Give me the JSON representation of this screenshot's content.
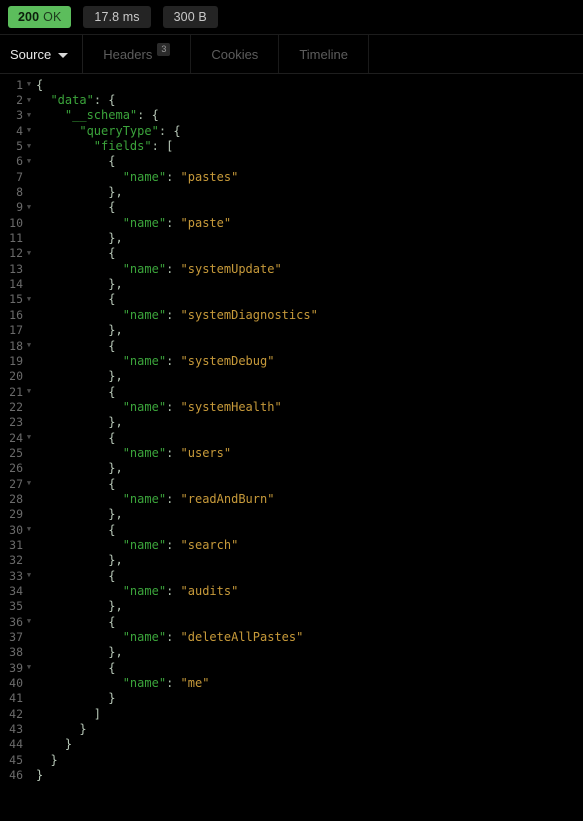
{
  "status": {
    "code": "200",
    "phrase": "OK",
    "code_color": "#5cbd5c",
    "time": "17.8 ms",
    "size": "300 B"
  },
  "tabs": {
    "source_label": "Source",
    "items": [
      {
        "label": "Headers",
        "badge": "3",
        "active": false
      },
      {
        "label": "Cookies",
        "badge": "",
        "active": false
      },
      {
        "label": "Timeline",
        "badge": "",
        "active": false
      }
    ]
  },
  "code": {
    "language": "json",
    "line_count": 46,
    "lines": [
      {
        "n": "1",
        "fold": true,
        "text": "{"
      },
      {
        "n": "2",
        "fold": true,
        "text": "  \"data\": {"
      },
      {
        "n": "3",
        "fold": true,
        "text": "    \"__schema\": {"
      },
      {
        "n": "4",
        "fold": true,
        "text": "      \"queryType\": {"
      },
      {
        "n": "5",
        "fold": true,
        "text": "        \"fields\": ["
      },
      {
        "n": "6",
        "fold": true,
        "text": "          {"
      },
      {
        "n": "7",
        "fold": false,
        "text": "            \"name\": \"pastes\""
      },
      {
        "n": "8",
        "fold": false,
        "text": "          },"
      },
      {
        "n": "9",
        "fold": true,
        "text": "          {"
      },
      {
        "n": "10",
        "fold": false,
        "text": "            \"name\": \"paste\""
      },
      {
        "n": "11",
        "fold": false,
        "text": "          },"
      },
      {
        "n": "12",
        "fold": true,
        "text": "          {"
      },
      {
        "n": "13",
        "fold": false,
        "text": "            \"name\": \"systemUpdate\""
      },
      {
        "n": "14",
        "fold": false,
        "text": "          },"
      },
      {
        "n": "15",
        "fold": true,
        "text": "          {"
      },
      {
        "n": "16",
        "fold": false,
        "text": "            \"name\": \"systemDiagnostics\""
      },
      {
        "n": "17",
        "fold": false,
        "text": "          },"
      },
      {
        "n": "18",
        "fold": true,
        "text": "          {"
      },
      {
        "n": "19",
        "fold": false,
        "text": "            \"name\": \"systemDebug\""
      },
      {
        "n": "20",
        "fold": false,
        "text": "          },"
      },
      {
        "n": "21",
        "fold": true,
        "text": "          {"
      },
      {
        "n": "22",
        "fold": false,
        "text": "            \"name\": \"systemHealth\""
      },
      {
        "n": "23",
        "fold": false,
        "text": "          },"
      },
      {
        "n": "24",
        "fold": true,
        "text": "          {"
      },
      {
        "n": "25",
        "fold": false,
        "text": "            \"name\": \"users\""
      },
      {
        "n": "26",
        "fold": false,
        "text": "          },"
      },
      {
        "n": "27",
        "fold": true,
        "text": "          {"
      },
      {
        "n": "28",
        "fold": false,
        "text": "            \"name\": \"readAndBurn\""
      },
      {
        "n": "29",
        "fold": false,
        "text": "          },"
      },
      {
        "n": "30",
        "fold": true,
        "text": "          {"
      },
      {
        "n": "31",
        "fold": false,
        "text": "            \"name\": \"search\""
      },
      {
        "n": "32",
        "fold": false,
        "text": "          },"
      },
      {
        "n": "33",
        "fold": true,
        "text": "          {"
      },
      {
        "n": "34",
        "fold": false,
        "text": "            \"name\": \"audits\""
      },
      {
        "n": "35",
        "fold": false,
        "text": "          },"
      },
      {
        "n": "36",
        "fold": true,
        "text": "          {"
      },
      {
        "n": "37",
        "fold": false,
        "text": "            \"name\": \"deleteAllPastes\""
      },
      {
        "n": "38",
        "fold": false,
        "text": "          },"
      },
      {
        "n": "39",
        "fold": true,
        "text": "          {"
      },
      {
        "n": "40",
        "fold": false,
        "text": "            \"name\": \"me\""
      },
      {
        "n": "41",
        "fold": false,
        "text": "          }"
      },
      {
        "n": "42",
        "fold": false,
        "text": "        ]"
      },
      {
        "n": "43",
        "fold": false,
        "text": "      }"
      },
      {
        "n": "44",
        "fold": false,
        "text": "    }"
      },
      {
        "n": "45",
        "fold": false,
        "text": "  }"
      },
      {
        "n": "46",
        "fold": false,
        "text": "}"
      }
    ],
    "field_names": [
      "pastes",
      "paste",
      "systemUpdate",
      "systemDiagnostics",
      "systemDebug",
      "systemHealth",
      "users",
      "readAndBurn",
      "search",
      "audits",
      "deleteAllPastes",
      "me"
    ]
  },
  "icons": {
    "fold_glyph": "▼",
    "caret_glyph": "▼"
  },
  "colors": {
    "background": "#000000",
    "status_ok": "#5cbd5c",
    "pill_bg": "#242424",
    "json_key": "#3ba43b",
    "json_string": "#c79a3a",
    "json_punct": "#b7c7b7",
    "line_number": "#6b6b6b"
  }
}
